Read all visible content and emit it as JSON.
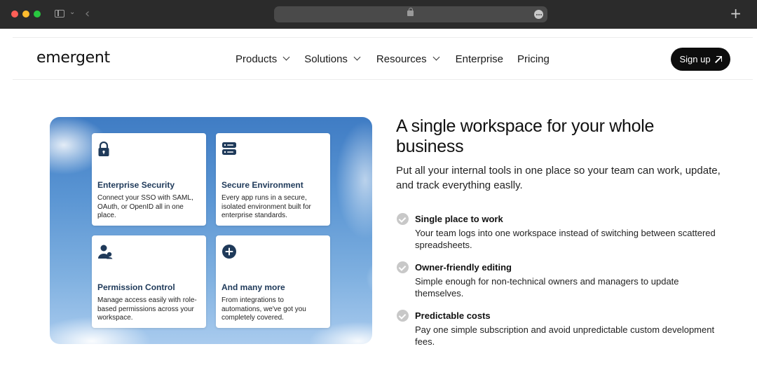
{
  "browser": {
    "new_tab_symbol": "+"
  },
  "nav": {
    "logo": "emergent",
    "items": [
      {
        "label": "Products"
      },
      {
        "label": "Solutions"
      },
      {
        "label": "Resources"
      },
      {
        "label": "Enterprise"
      },
      {
        "label": "Pricing"
      }
    ],
    "signup_label": "Sign up"
  },
  "cards": [
    {
      "icon": "lock-icon",
      "title": "Enterprise Security",
      "desc": "Connect your SSO with SAML, OAuth, or OpenID all in one place."
    },
    {
      "icon": "server-icon",
      "title": "Secure Environment",
      "desc": "Every app runs in a secure, isolated environment built for enterprise standards."
    },
    {
      "icon": "users-icon",
      "title": "Permission Control",
      "desc": "Manage access easily with role-based permissions across your workspace."
    },
    {
      "icon": "plus-circle-icon",
      "title": "And many more",
      "desc": "From integrations to automations, we've got you completely covered."
    }
  ],
  "main": {
    "headline": "A single workspace for your whole business",
    "subhead": "Put all your internal tools in one place so your team can work, update, and track everything easlly.",
    "features": [
      {
        "title": "Single place to work",
        "desc": "Your team logs into one workspace instead of switching between scattered spreadsheets."
      },
      {
        "title": "Owner-friendly editing",
        "desc": "Simple enough for non-technical owners and managers to update themselves."
      },
      {
        "title": "Predictable costs",
        "desc": "Pay one simple subscription and avoid unpredictable custom development fees."
      }
    ]
  },
  "colors": {
    "card_title": "#1f3a5a",
    "icon_fill": "#1f3a5a",
    "signup_bg": "#0d0d0d",
    "check_bg": "#c8c8c8"
  }
}
